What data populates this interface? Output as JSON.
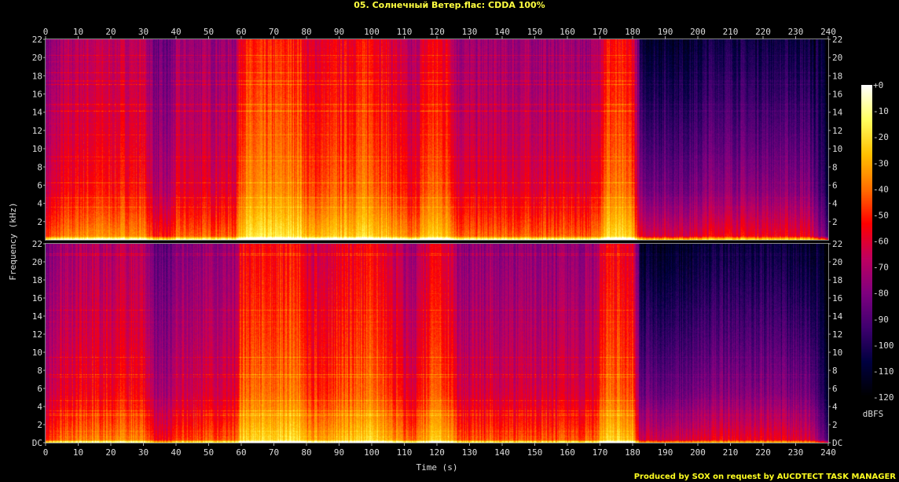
{
  "title": "05. Солнечный Ветер.flac: CDDA 100%",
  "footer": "Produced by SOX on request by AUCDTECT TASK MANAGER",
  "chart_data": {
    "type": "heatmap",
    "subtype": "spectrogram",
    "channels": 2,
    "xlabel": "Time (s)",
    "ylabel": "Frequency (kHz)",
    "xlim": [
      0,
      240
    ],
    "ylim": [
      0,
      22
    ],
    "x_ticks": [
      "0",
      "10",
      "20",
      "30",
      "40",
      "50",
      "60",
      "70",
      "80",
      "90",
      "100",
      "110",
      "120",
      "130",
      "140",
      "150",
      "160",
      "170",
      "180",
      "190",
      "200",
      "210",
      "220",
      "230",
      "240"
    ],
    "y_ticks_top": [
      "2",
      "4",
      "6",
      "8",
      "10",
      "12",
      "14",
      "16",
      "18",
      "20",
      "22"
    ],
    "y_ticks_bottom": [
      "DC",
      "2",
      "4",
      "6",
      "8",
      "10",
      "12",
      "14",
      "16",
      "18",
      "20",
      "22"
    ],
    "colorbar": {
      "label": "dBFS",
      "range": [
        -120,
        0
      ],
      "ticks": [
        "+0",
        "-10",
        "-20",
        "-30",
        "-40",
        "-50",
        "-60",
        "-70",
        "-80",
        "-90",
        "-100",
        "-110",
        "-120"
      ],
      "colors": [
        "#000000",
        "#000040",
        "#400070",
        "#800080",
        "#c00060",
        "#ff0000",
        "#ff7000",
        "#ffc000",
        "#ffff60",
        "#ffffff"
      ]
    }
  }
}
